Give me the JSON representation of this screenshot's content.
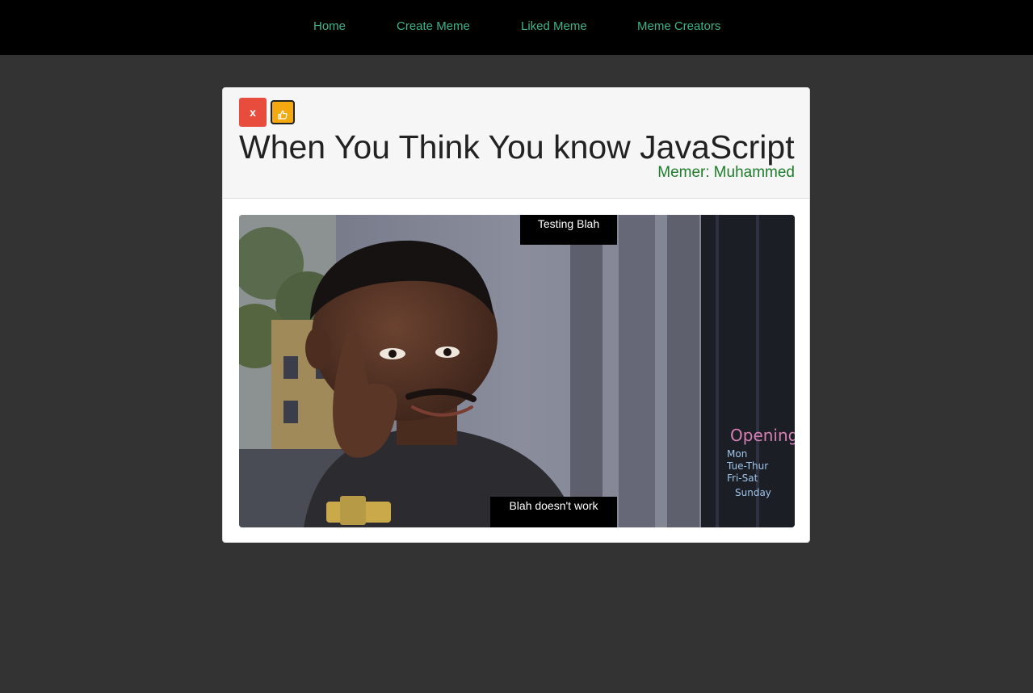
{
  "nav": {
    "items": [
      {
        "label": "Home"
      },
      {
        "label": "Create Meme"
      },
      {
        "label": "Liked Meme"
      },
      {
        "label": "Meme Creators"
      }
    ]
  },
  "meme": {
    "delete_label": "x",
    "like_icon": "thumbs-up-icon",
    "title": "When You Think You know JavaScript",
    "memer_label": "Memer:",
    "memer_name": "Muhammed",
    "top_text": "Testing Blah",
    "bottom_text": "Blah doesn't work",
    "sign_text": "Opening Mon Tue-Thur Fri-Sat Sunday"
  },
  "colors": {
    "nav_background": "#000000",
    "nav_link": "#3cb48a",
    "page_background": "#333333",
    "delete_button": "#e74c3c",
    "like_button": "#f3a90f",
    "memer_text": "#1e7d2b"
  }
}
